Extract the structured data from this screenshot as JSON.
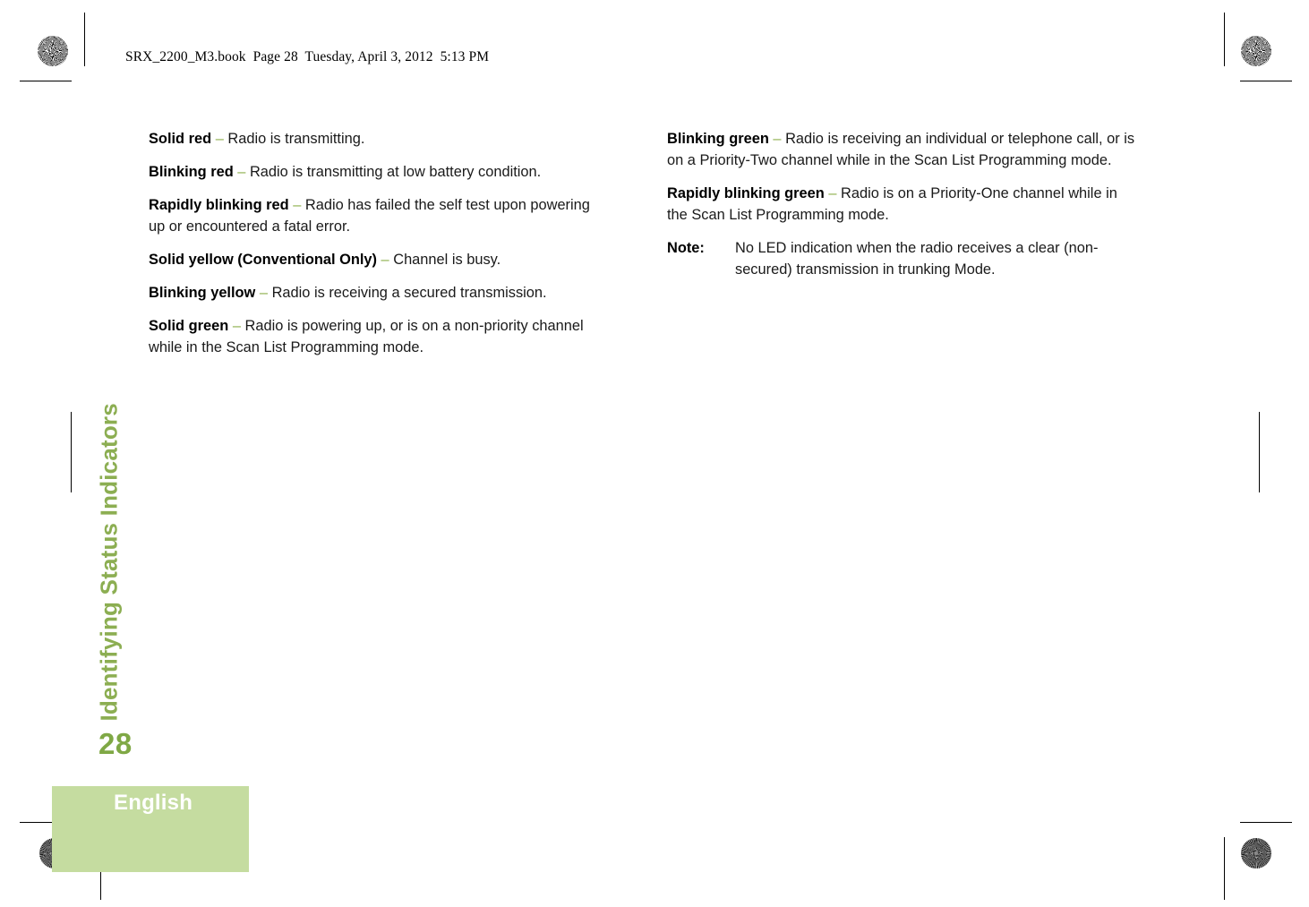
{
  "document": {
    "slug": "SRX_2200_M3.book  Page 28  Tuesday, April 3, 2012  5:13 PM",
    "side_heading": "Identifying Status Indicators",
    "page_number": "28",
    "language": "English"
  },
  "colors": {
    "accent_green": "#8CAE52",
    "page_number_green": "#7FA845",
    "dash_green": "#8CAF4B",
    "language_block_green": "#C5DCA0",
    "language_text": "#FFFFFF",
    "body_text": "#1A1A1A"
  },
  "left_column": {
    "items": [
      {
        "term": "Solid red",
        "dash": "–",
        "description": "Radio is transmitting."
      },
      {
        "term": "Blinking red",
        "dash": "–",
        "description": "Radio is transmitting at low battery condition."
      },
      {
        "term": "Rapidly blinking red",
        "dash": "–",
        "description": "Radio has failed the self test upon powering up or encountered a fatal error."
      },
      {
        "term": "Solid yellow (Conventional Only)",
        "dash": "–",
        "description": "Channel is busy."
      },
      {
        "term": "Blinking yellow",
        "dash": "–",
        "description": "Radio is receiving a secured transmission."
      },
      {
        "term": "Solid green",
        "dash": "–",
        "description": "Radio is powering up, or is on a non-priority channel while in the Scan List Programming mode."
      }
    ]
  },
  "right_column": {
    "items": [
      {
        "term": "Blinking green",
        "dash": "–",
        "description": "Radio is receiving an individual or telephone call, or is on a Priority-Two channel while in the Scan List Programming mode."
      },
      {
        "term": "Rapidly blinking green",
        "dash": "–",
        "description": "Radio is on a Priority-One channel while in the Scan List Programming mode."
      }
    ],
    "note": {
      "label": "Note:",
      "text": "No LED indication when the radio receives a clear (non-secured) transmission in trunking Mode."
    }
  }
}
